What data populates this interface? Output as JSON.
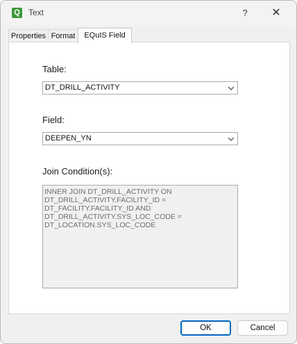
{
  "window": {
    "title": "Text",
    "help_symbol": "?",
    "close_symbol": "✕",
    "app_icon_glyph": "Q"
  },
  "tabs": [
    {
      "label": "Properties"
    },
    {
      "label": "Format"
    },
    {
      "label": "EQuIS Field",
      "selected": true
    }
  ],
  "form": {
    "table_label": "Table:",
    "table_value": "DT_DRILL_ACTIVITY",
    "field_label": "Field:",
    "field_value": "DEEPEN_YN",
    "join_label": "Join Condition(s):",
    "join_text": "INNER JOIN DT_DRILL_ACTIVITY ON\nDT_DRILL_ACTIVITY.FACILITY_ID =\nDT_FACILITY.FACILITY_ID AND\nDT_DRILL_ACTIVITY.SYS_LOC_CODE =\nDT_LOCATION.SYS_LOC_CODE"
  },
  "buttons": {
    "ok": "OK",
    "cancel": "Cancel"
  },
  "icons": {
    "app": "equis-app-icon",
    "help": "help-icon",
    "close": "close-icon",
    "dropdown": "chevron-down-icon"
  },
  "colors": {
    "accent": "#0067c0",
    "app_icon": "#3b9a3b"
  }
}
